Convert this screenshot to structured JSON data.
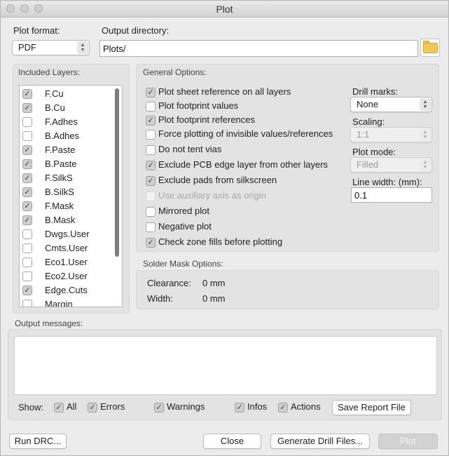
{
  "window": {
    "title": "Plot"
  },
  "plot_format": {
    "label": "Plot format:",
    "value": "PDF"
  },
  "output_directory": {
    "label": "Output directory:",
    "value": "Plots/",
    "browse_icon": "folder-icon"
  },
  "included_layers": {
    "label": "Included Layers:",
    "items": [
      {
        "name": "F.Cu",
        "checked": true
      },
      {
        "name": "B.Cu",
        "checked": true
      },
      {
        "name": "F.Adhes",
        "checked": false
      },
      {
        "name": "B.Adhes",
        "checked": false
      },
      {
        "name": "F.Paste",
        "checked": true
      },
      {
        "name": "B.Paste",
        "checked": true
      },
      {
        "name": "F.SilkS",
        "checked": true
      },
      {
        "name": "B.SilkS",
        "checked": true
      },
      {
        "name": "F.Mask",
        "checked": true
      },
      {
        "name": "B.Mask",
        "checked": true
      },
      {
        "name": "Dwgs.User",
        "checked": false
      },
      {
        "name": "Cmts.User",
        "checked": false
      },
      {
        "name": "Eco1.User",
        "checked": false
      },
      {
        "name": "Eco2.User",
        "checked": false
      },
      {
        "name": "Edge.Cuts",
        "checked": true
      },
      {
        "name": "Margin",
        "checked": false
      }
    ]
  },
  "general_options": {
    "label": "General Options:",
    "options": [
      {
        "label": "Plot sheet reference on all layers",
        "checked": true,
        "disabled": false
      },
      {
        "label": "Plot footprint values",
        "checked": false,
        "disabled": false
      },
      {
        "label": "Plot footprint references",
        "checked": true,
        "disabled": false
      },
      {
        "label": "Force plotting of invisible values/references",
        "checked": false,
        "disabled": false
      },
      {
        "label": "Do not tent vias",
        "checked": false,
        "disabled": false
      },
      {
        "label": "Exclude PCB edge layer from other layers",
        "checked": true,
        "disabled": false
      },
      {
        "label": "Exclude pads from silkscreen",
        "checked": true,
        "disabled": false
      },
      {
        "label": "Use auxiliary axis as origin",
        "checked": false,
        "disabled": true
      },
      {
        "label": "Mirrored plot",
        "checked": false,
        "disabled": false
      },
      {
        "label": "Negative plot",
        "checked": false,
        "disabled": false
      },
      {
        "label": "Check zone fills before plotting",
        "checked": true,
        "disabled": false
      }
    ],
    "drill_marks": {
      "label": "Drill marks:",
      "value": "None"
    },
    "scaling": {
      "label": "Scaling:",
      "value": "1:1"
    },
    "plot_mode": {
      "label": "Plot mode:",
      "value": "Filled"
    },
    "line_width": {
      "label": "Line width: (mm):",
      "value": "0.1"
    }
  },
  "solder_mask": {
    "label": "Solder Mask Options:",
    "clearance_label": "Clearance:",
    "clearance_value": "0 mm",
    "width_label": "Width:",
    "width_value": "0 mm"
  },
  "output_messages": {
    "label": "Output messages:",
    "show_label": "Show:",
    "filters": [
      {
        "label": "All",
        "checked": true
      },
      {
        "label": "Errors",
        "checked": true
      },
      {
        "label": "Warnings",
        "checked": true
      },
      {
        "label": "Infos",
        "checked": true
      },
      {
        "label": "Actions",
        "checked": true
      }
    ],
    "save_report": "Save Report File"
  },
  "buttons": {
    "run_drc": "Run DRC...",
    "close": "Close",
    "generate_drill": "Generate Drill Files...",
    "plot": "Plot"
  },
  "check_glyph": "✓"
}
